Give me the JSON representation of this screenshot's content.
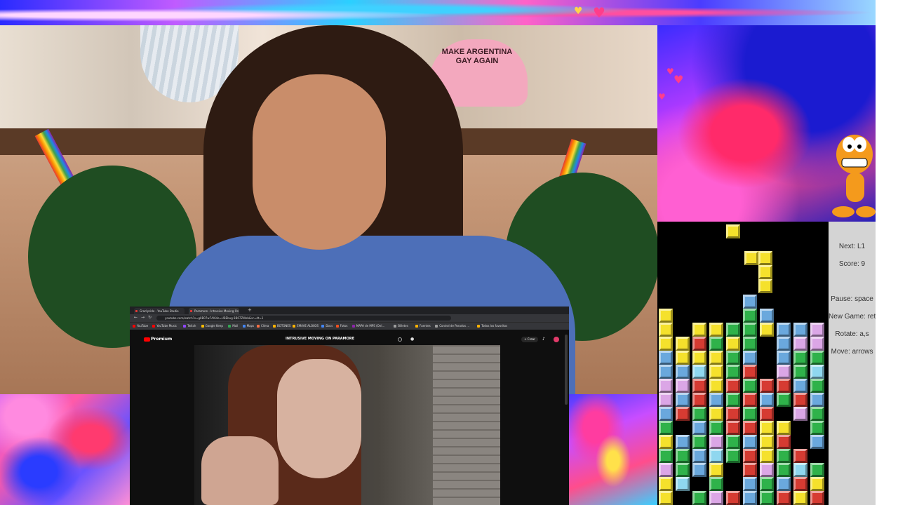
{
  "webcam": {
    "cap_text": "MAKE ARGENTINA GAY AGAIN"
  },
  "browser": {
    "tabs": [
      {
        "label": "Grad pride - YouTube Studio",
        "active": false
      },
      {
        "label": "Paramore - Intrusive Moving On",
        "active": true
      }
    ],
    "url": "youtube.com/watch?v=g8B07w7Al64e=UBEbug 8B07ZWeb&vr=dt=1",
    "bookmarks": [
      {
        "label": "YouTube",
        "color": "#ff0000"
      },
      {
        "label": "YouTube Music",
        "color": "#ff0000"
      },
      {
        "label": "Twitch",
        "color": "#9146ff"
      },
      {
        "label": "Google Keep",
        "color": "#fbbc04"
      },
      {
        "label": "Mail",
        "color": "#34a853"
      },
      {
        "label": "Maps",
        "color": "#4285f4"
      },
      {
        "label": "Clima",
        "color": "#ff7043"
      },
      {
        "label": "BOTONES",
        "color": "#ffb300"
      },
      {
        "label": "EMAVE ALOXOS",
        "color": "#ffb300"
      },
      {
        "label": "Docs",
        "color": "#4285f4"
      },
      {
        "label": "Fotos",
        "color": "#f4511e"
      },
      {
        "label": "MAPA de MPS (Onl...",
        "color": "#8e24aa"
      },
      {
        "label": "Billetes",
        "color": "#9e9e9e"
      },
      {
        "label": "Fuentes",
        "color": "#ffb300"
      },
      {
        "label": "Control de Parados ...",
        "color": "#9e9e9e"
      },
      {
        "label": "Todos los favoritos",
        "color": "#ffb300"
      }
    ]
  },
  "youtube": {
    "logo": "Premium",
    "video_title": "INTRUSIVE MOVING ON  PARAMORE",
    "create_label": "+ Crear"
  },
  "tetris": {
    "next_label": "Next: L1",
    "score_label": "Score: 9",
    "pause_label": "Pause: space",
    "new_game_label": "New Game: return",
    "rotate_label": "Rotate: a,s",
    "move_label": "Move: arrows",
    "colors": {
      "Y": "#f5e12c",
      "B": "#6aa8dd",
      "G": "#2fb24a",
      "R": "#d63b32",
      "P": "#dba6e6",
      "L": "#8fd7ef"
    },
    "falling_piece": [
      [
        0,
        0
      ],
      [
        1,
        0
      ],
      [
        1,
        1
      ],
      [
        1,
        2
      ]
    ],
    "board": [
      "..........",
      "....Y.....",
      "..........",
      "..........",
      "..........",
      "..........",
      ".....B....",
      "Y....GB...",
      "Y.YYGGYBBP",
      "YYRGYG.BPP",
      "BYYYGB.BGG",
      "BBLYGR.PGL",
      "PPRYRGRRBG",
      "PBRBGRBGRB",
      "BRGYRGR.PG",
      "G.BGRRYY.G",
      "YBGPGBYR.B",
      "GGBLGRYGR.",
      "PGBY.RPGLG",
      "YL.G.BGBRY",
      "Y.GPRBGRYR"
    ]
  }
}
